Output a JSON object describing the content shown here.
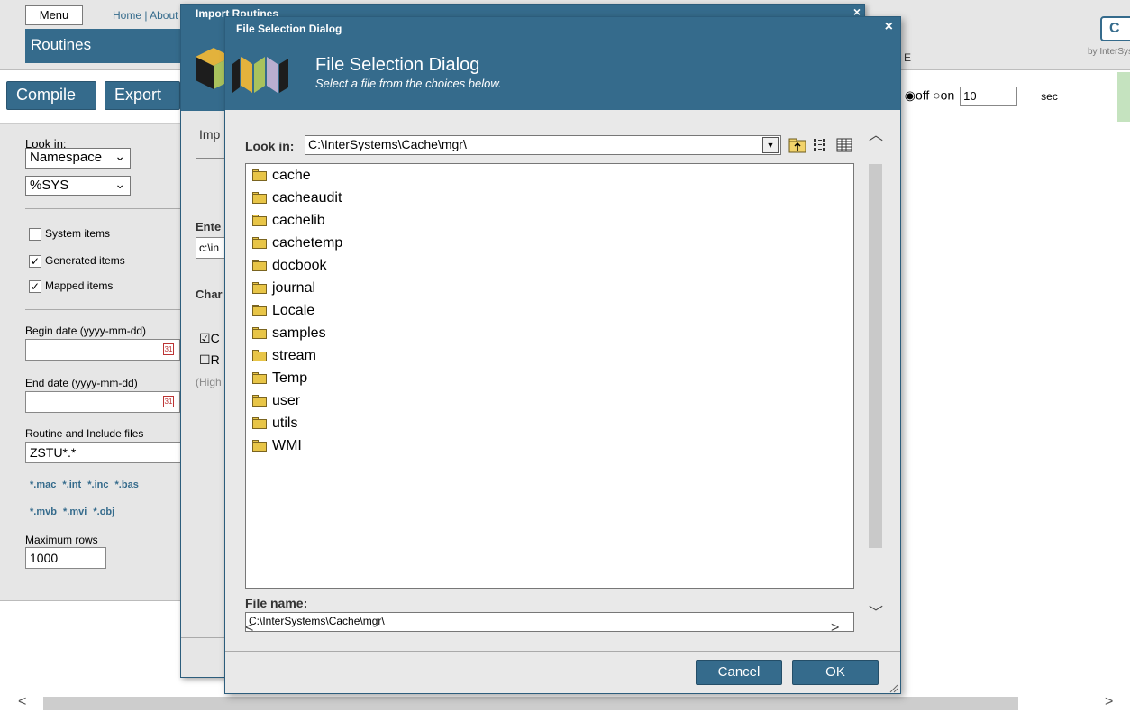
{
  "app": {
    "menu_label": "Menu",
    "top_links": "Home | About",
    "tab_title": "Routines",
    "byline": "by InterSystems",
    "logo_letters": "C",
    "truncated_heading_letter": "E"
  },
  "toolbar": {
    "compile_label": "Compile",
    "export_label": "Export"
  },
  "refresh": {
    "off_label": "off",
    "on_label": "on",
    "interval_value": "10",
    "unit_label": "sec"
  },
  "sidepanel": {
    "look_in_label": "Look in:",
    "namespace_select": "Namespace",
    "namespace_value": "%SYS",
    "system_items_label": "System items",
    "system_items_checked": false,
    "generated_items_label": "Generated items",
    "generated_items_checked": true,
    "mapped_items_label": "Mapped items",
    "mapped_items_checked": true,
    "begin_date_label": "Begin date (yyyy-mm-dd)",
    "begin_date_value": "",
    "end_date_label": "End date (yyyy-mm-dd)",
    "end_date_value": "",
    "routine_files_label": "Routine and Include files",
    "routine_files_value": "ZSTU*.*",
    "ext_links_row1": "*.mac *.int *.inc *.bas",
    "ext_links_row2": "*.mvb *.mvi *.obj",
    "max_rows_label": "Maximum rows",
    "max_rows_value": "1000"
  },
  "import_dialog": {
    "title": "Import Routines",
    "body_label": "Imp",
    "enter_label": "Ente",
    "path_value": "c:\\in",
    "charset_label": "Char",
    "option1": "C",
    "option2": "R",
    "hint": "(High"
  },
  "file_dialog": {
    "titlebar": "File Selection Dialog",
    "header_title": "File Selection Dialog",
    "header_subtitle": "Select a file from the choices below.",
    "look_in_label": "Look in:",
    "look_in_value": "C:\\InterSystems\\Cache\\mgr\\",
    "file_name_label": "File name:",
    "file_name_value": "C:\\InterSystems\\Cache\\mgr\\",
    "cancel_label": "Cancel",
    "ok_label": "OK",
    "folders": [
      "cache",
      "cacheaudit",
      "cachelib",
      "cachetemp",
      "docbook",
      "journal",
      "Locale",
      "samples",
      "stream",
      "Temp",
      "user",
      "utils",
      "WMI"
    ]
  },
  "colors": {
    "brand": "#356b8c",
    "panel": "#e6e6e6",
    "folder": "#e8c547"
  },
  "icons": [
    "folder-icon",
    "folder-up-icon",
    "list-view-icon",
    "details-view-icon",
    "calendar-icon",
    "close-icon",
    "dropdown-arrow-icon",
    "resize-grip-icon"
  ]
}
